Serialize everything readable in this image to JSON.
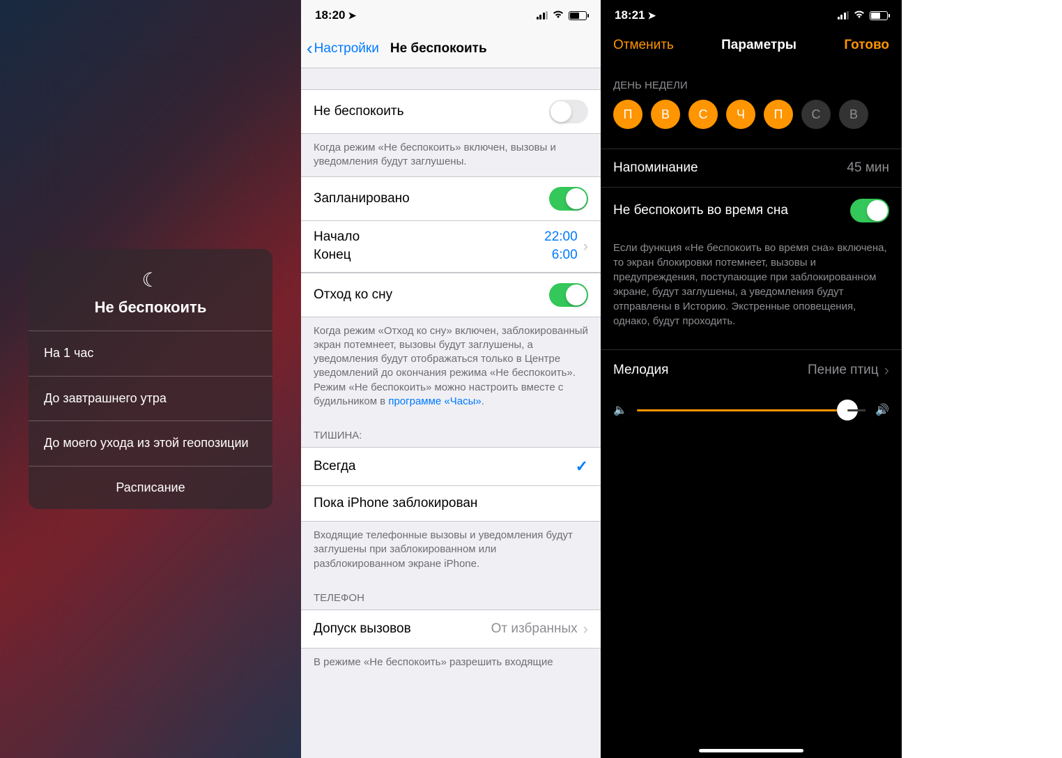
{
  "s1": {
    "title": "Не беспокоить",
    "opt1": "На 1 час",
    "opt2": "До завтрашнего утра",
    "opt3": "До моего ухода из этой геопозиции",
    "footer": "Расписание"
  },
  "s2": {
    "time": "18:20",
    "back": "Настройки",
    "title": "Не беспокоить",
    "dnd_label": "Не беспокоить",
    "dnd_footer": "Когда режим «Не беспокоить» включен, вызовы и уведомления будут заглушены.",
    "sched_label": "Запланировано",
    "start_label": "Начало",
    "start_value": "22:00",
    "end_label": "Конец",
    "end_value": "6:00",
    "bedtime_label": "Отход ко сну",
    "bedtime_footer_a": "Когда режим «Отход ко сну» включен, заблокированный экран потемнеет, вызовы будут заглушены, а уведомления будут отображаться только в Центре уведомлений до окончания режима «Не беспокоить». Режим «Не беспокоить» можно настроить вместе с будильником в ",
    "bedtime_footer_link": "программе «Часы»",
    "silence_header": "ТИШИНА:",
    "always": "Всегда",
    "locked": "Пока iPhone заблокирован",
    "silence_footer": "Входящие телефонные вызовы и уведомления будут заглушены при заблокированном или разблокированном экране iPhone.",
    "phone_header": "ТЕЛЕФОН",
    "allow_label": "Допуск вызовов",
    "allow_value": "От избранных",
    "allow_footer": "В режиме «Не беспокоить» разрешить входящие"
  },
  "s3": {
    "time": "18:21",
    "cancel": "Отменить",
    "title": "Параметры",
    "done": "Готово",
    "days_header": "ДЕНЬ НЕДЕЛИ",
    "days": [
      "П",
      "В",
      "С",
      "Ч",
      "П",
      "С",
      "В"
    ],
    "days_on": [
      true,
      true,
      true,
      true,
      true,
      false,
      false
    ],
    "reminder_label": "Напоминание",
    "reminder_value": "45 мин",
    "dnd_sleep_label": "Не беспокоить во время сна",
    "dnd_sleep_footer": "Если функция «Не беспокоить во время сна» включена, то экран блокировки потемнеет, вызовы и предупреждения, поступающие при заблокированном экране, будут заглушены, а уведомления будут отправлены в Историю. Экстренные оповещения, однако, будут проходить.",
    "melody_label": "Мелодия",
    "melody_value": "Пение птиц"
  }
}
